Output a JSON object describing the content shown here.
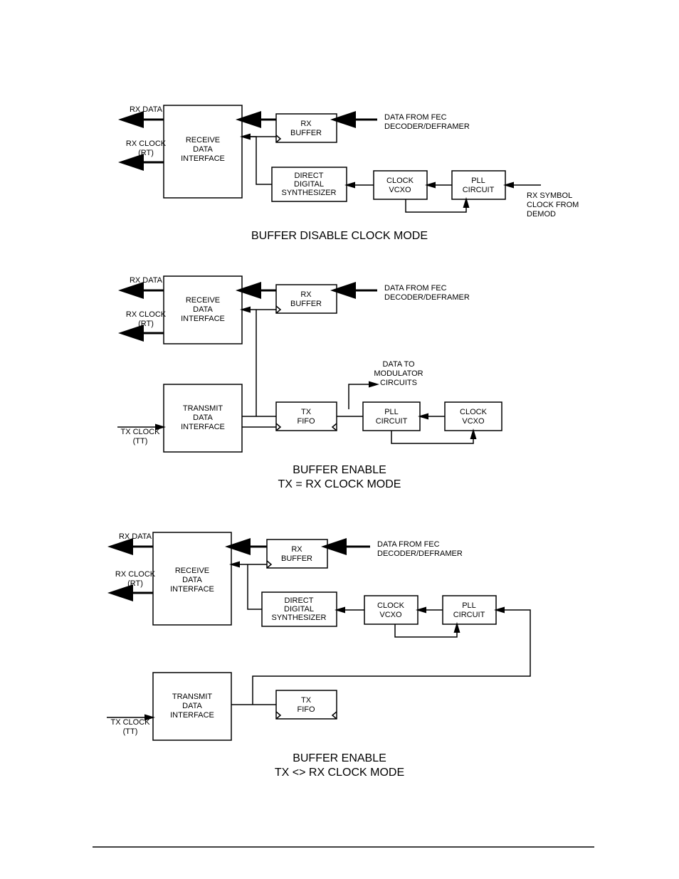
{
  "labels": {
    "rxdata": "RX DATA",
    "rxclock": "RX CLOCK",
    "rt": "(RT)",
    "txclock": "TX CLOCK",
    "tt": "(TT)",
    "rdi1": "RECEIVE",
    "rdi2": "DATA",
    "rdi3": "INTERFACE",
    "tdi1": "TRANSMIT",
    "tdi2": "DATA",
    "tdi3": "INTERFACE",
    "rxbuf1": "RX",
    "rxbuf2": "BUFFER",
    "dds1": "DIRECT",
    "dds2": "DIGITAL",
    "dds3": "SYNTHESIZER",
    "clk1": "CLOCK",
    "clk2": "VCXO",
    "pll1": "PLL",
    "pll2": "CIRCUIT",
    "txf1": "TX",
    "txf2": "FIFO",
    "fec1": "DATA FROM FEC",
    "fec2": "DECODER/DEFRAMER",
    "dm1": "DATA TO",
    "dm2": "MODULATOR",
    "dm3": "CIRCUITS",
    "rs1": "RX SYMBOL",
    "rs2": "CLOCK FROM",
    "rs3": "DEMOD",
    "t1": "BUFFER DISABLE CLOCK MODE",
    "t2a": "BUFFER ENABLE",
    "t2b": "TX = RX CLOCK MODE",
    "t3a": "BUFFER ENABLE",
    "t3b": "TX <> RX CLOCK MODE"
  }
}
